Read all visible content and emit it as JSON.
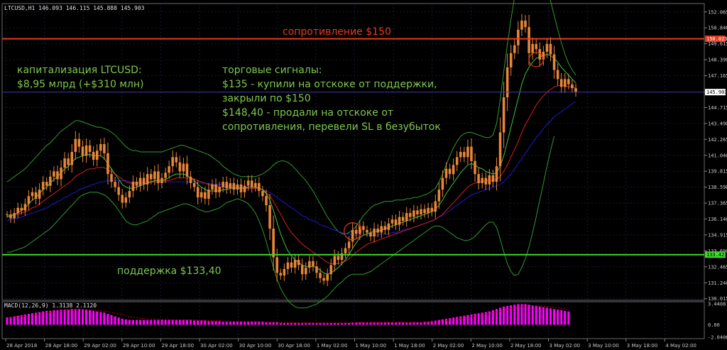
{
  "symbol_info": "LTCUSD,H1  146.093 146.115 145.888 145.903",
  "macd_info": "MACD(12,26,9) 1.3138 2.1120",
  "colors": {
    "resistance": "#e83a1e",
    "support": "#3cdc28",
    "note": "#7ec850",
    "candle": "#e8863a",
    "bb": "#2f9a2f",
    "ma_fast": "#3cc43c",
    "ma_mid": "#d81e1e",
    "ma_slow": "#1a1ad0",
    "macd_hist": "#ff00ff",
    "macd_signal": "#c80000",
    "grid": "#2a2a55",
    "axis_text": "#c8c8c8"
  },
  "annotations": {
    "resistance_label": "сопротивление $150",
    "support_label": "поддержка $133,40",
    "cap_line1": "капитализация LTCUSD:",
    "cap_line2": "$8,95 млрд (+$310 млн)",
    "signals_line1": "торговые сигналы:",
    "signals_line2": "$135 - купили на отскоке от поддержки,",
    "signals_line3": "закрыли по $150",
    "signals_line4": "$148,40 - продали на отскоке от",
    "signals_line5": "сопротивления, перевели SL в безубыток"
  },
  "price_scale": {
    "ticks": [
      "152.065",
      "150.840",
      "149.615",
      "148.390",
      "147.165",
      "145.903",
      "144.715",
      "143.490",
      "142.265",
      "141.040",
      "139.815",
      "138.590",
      "137.365",
      "136.140",
      "134.915",
      "133.690",
      "132.465",
      "131.240",
      "130.015"
    ],
    "resistance_tag": "150.023",
    "support_tag": "133.421",
    "current_tag": "145.903"
  },
  "macd_scale": {
    "ticks": [
      "3.4408",
      "0.00",
      "-2.0406"
    ]
  },
  "time_axis": {
    "labels": [
      "28 Apr 2018",
      "28 Apr 18:00",
      "29 Apr 02:00",
      "29 Apr 10:00",
      "29 Apr 18:00",
      "30 Apr 02:00",
      "30 Apr 10:00",
      "30 Apr 18:00",
      "1 May 02:00",
      "1 May 10:00",
      "1 May 18:00",
      "2 May 02:00",
      "2 May 10:00",
      "2 May 18:00",
      "3 May 02:00",
      "3 May 10:00",
      "3 May 18:00",
      "4 May 02:00"
    ]
  },
  "chart_data": {
    "type": "candlestick",
    "symbol": "LTCUSD",
    "timeframe": "H1",
    "y_range": [
      130.0,
      152.6
    ],
    "resistance": 150.0,
    "support": 133.4,
    "closes": [
      136.5,
      136.2,
      136.6,
      137.0,
      136.8,
      137.3,
      137.9,
      138.2,
      137.7,
      138.4,
      139.0,
      138.7,
      139.4,
      139.8,
      139.2,
      140.1,
      140.8,
      140.3,
      141.3,
      142.3,
      141.7,
      141.0,
      141.8,
      141.3,
      140.7,
      141.4,
      141.9,
      141.2,
      139.6,
      139.0,
      138.6,
      138.0,
      137.4,
      137.8,
      138.3,
      139.0,
      138.7,
      139.3,
      138.8,
      139.6,
      139.2,
      139.8,
      138.9,
      139.3,
      139.7,
      140.2,
      140.9,
      140.5,
      139.8,
      140.4,
      139.4,
      138.9,
      138.6,
      137.8,
      138.2,
      137.7,
      138.4,
      138.8,
      138.2,
      138.6,
      139.0,
      138.5,
      138.9,
      138.4,
      138.8,
      138.2,
      138.7,
      139.1,
      138.6,
      138.9,
      138.3,
      137.9,
      137.2,
      135.4,
      133.2,
      132.0,
      131.8,
      132.3,
      132.8,
      132.4,
      133.0,
      132.6,
      131.9,
      132.4,
      132.9,
      132.5,
      132.0,
      131.6,
      131.4,
      131.9,
      132.6,
      133.3,
      133.0,
      133.5,
      133.9,
      134.4,
      135.3,
      135.0,
      135.6,
      135.3,
      135.1,
      134.8,
      135.4,
      135.1,
      135.6,
      135.3,
      135.8,
      136.1,
      135.7,
      136.3,
      136.0,
      136.6,
      136.3,
      136.8,
      136.5,
      136.9,
      136.6,
      137.0,
      136.7,
      137.5,
      138.4,
      139.3,
      140.0,
      139.6,
      140.3,
      140.9,
      141.3,
      140.9,
      141.7,
      140.6,
      139.6,
      138.9,
      139.3,
      138.8,
      139.5,
      139.0,
      140.2,
      142.8,
      145.5,
      147.8,
      148.9,
      149.5,
      150.7,
      151.4,
      150.9,
      148.9,
      149.6,
      149.2,
      148.4,
      149.0,
      149.6,
      148.8,
      147.6,
      146.9,
      146.3,
      146.9,
      146.5,
      146.2,
      145.9
    ],
    "ma_fast": [
      136.3,
      136.4,
      136.5,
      136.6,
      136.8,
      137.0,
      137.3,
      137.6,
      137.8,
      138.1,
      138.4,
      138.6,
      138.9,
      139.2,
      139.4,
      139.7,
      140.0,
      140.2,
      140.5,
      140.8,
      140.9,
      141.0,
      141.1,
      141.1,
      141.0,
      141.0,
      141.0,
      140.8,
      140.4,
      140.0,
      139.6,
      139.2,
      138.8,
      138.6,
      138.5,
      138.5,
      138.6,
      138.7,
      138.8,
      138.9,
      139.0,
      139.1,
      139.1,
      139.1,
      139.2,
      139.3,
      139.5,
      139.6,
      139.6,
      139.6,
      139.5,
      139.3,
      139.1,
      138.8,
      138.6,
      138.4,
      138.3,
      138.3,
      138.3,
      138.3,
      138.4,
      138.4,
      138.5,
      138.5,
      138.5,
      138.5,
      138.5,
      138.6,
      138.6,
      138.6,
      138.5,
      138.4,
      138.1,
      137.6,
      136.8,
      135.9,
      135.0,
      134.3,
      133.7,
      133.3,
      133.0,
      132.8,
      132.6,
      132.5,
      132.5,
      132.5,
      132.4,
      132.2,
      132.0,
      131.9,
      132.0,
      132.2,
      132.4,
      132.7,
      133.0,
      133.4,
      133.9,
      134.3,
      134.7,
      134.9,
      135.0,
      135.1,
      135.2,
      135.2,
      135.3,
      135.4,
      135.5,
      135.6,
      135.7,
      135.8,
      135.9,
      136.0,
      136.1,
      136.2,
      136.3,
      136.4,
      136.5,
      136.6,
      136.7,
      136.9,
      137.2,
      137.6,
      138.1,
      138.5,
      138.9,
      139.3,
      139.7,
      140.0,
      140.3,
      140.4,
      140.3,
      140.1,
      140.0,
      139.8,
      139.7,
      139.6,
      139.7,
      140.2,
      141.0,
      142.1,
      143.2,
      144.3,
      145.4,
      146.5,
      147.3,
      147.8,
      148.2,
      148.5,
      148.6,
      148.7,
      148.8,
      148.7,
      148.5,
      148.2,
      147.8,
      147.5,
      147.2,
      146.9,
      146.6
    ],
    "ma_mid": [
      136.4,
      136.4,
      136.5,
      136.5,
      136.6,
      136.7,
      136.8,
      137.0,
      137.1,
      137.3,
      137.5,
      137.7,
      137.9,
      138.1,
      138.3,
      138.5,
      138.7,
      138.9,
      139.1,
      139.4,
      139.6,
      139.7,
      139.9,
      140.0,
      140.0,
      140.1,
      140.1,
      140.1,
      139.9,
      139.8,
      139.6,
      139.4,
      139.2,
      139.0,
      138.9,
      138.9,
      138.9,
      138.9,
      138.9,
      138.9,
      139.0,
      139.0,
      139.0,
      139.0,
      139.1,
      139.1,
      139.2,
      139.3,
      139.3,
      139.3,
      139.3,
      139.3,
      139.2,
      139.1,
      139.0,
      138.9,
      138.8,
      138.7,
      138.7,
      138.6,
      138.6,
      138.6,
      138.6,
      138.6,
      138.6,
      138.5,
      138.5,
      138.5,
      138.5,
      138.5,
      138.5,
      138.4,
      138.2,
      137.9,
      137.5,
      137.0,
      136.5,
      136.0,
      135.5,
      135.1,
      134.8,
      134.5,
      134.2,
      134.0,
      133.8,
      133.6,
      133.4,
      133.2,
      133.0,
      132.8,
      132.7,
      132.7,
      132.7,
      132.8,
      132.9,
      133.1,
      133.3,
      133.6,
      133.8,
      134.0,
      134.2,
      134.3,
      134.4,
      134.5,
      134.6,
      134.7,
      134.8,
      134.9,
      135.0,
      135.1,
      135.2,
      135.3,
      135.4,
      135.5,
      135.6,
      135.7,
      135.8,
      135.9,
      136.0,
      136.1,
      136.3,
      136.5,
      136.8,
      137.1,
      137.4,
      137.7,
      138.0,
      138.3,
      138.6,
      138.8,
      138.9,
      139.0,
      139.0,
      139.1,
      139.1,
      139.1,
      139.2,
      139.4,
      139.8,
      140.3,
      140.9,
      141.5,
      142.1,
      142.8,
      143.4,
      143.9,
      144.4,
      144.9,
      145.3,
      145.6,
      145.9,
      146.1,
      146.3,
      146.4,
      146.4,
      146.4,
      146.3,
      146.3,
      146.2
    ],
    "ma_slow": [
      136.0,
      136.1,
      136.2,
      136.2,
      136.3,
      136.4,
      136.5,
      136.6,
      136.7,
      136.8,
      136.9,
      137.0,
      137.2,
      137.3,
      137.5,
      137.6,
      137.8,
      137.9,
      138.1,
      138.2,
      138.4,
      138.5,
      138.6,
      138.7,
      138.8,
      138.9,
      139.0,
      139.0,
      139.1,
      139.1,
      139.1,
      139.1,
      139.1,
      139.1,
      139.0,
      139.0,
      139.0,
      139.0,
      139.0,
      139.0,
      139.0,
      139.0,
      139.0,
      139.0,
      139.0,
      139.0,
      139.0,
      139.0,
      139.0,
      139.0,
      139.0,
      139.0,
      139.0,
      138.9,
      138.9,
      138.9,
      138.9,
      138.8,
      138.8,
      138.8,
      138.8,
      138.7,
      138.7,
      138.7,
      138.7,
      138.6,
      138.6,
      138.6,
      138.6,
      138.5,
      138.5,
      138.4,
      138.3,
      138.2,
      138.0,
      137.8,
      137.6,
      137.4,
      137.2,
      137.0,
      136.8,
      136.6,
      136.4,
      136.3,
      136.1,
      136.0,
      135.9,
      135.7,
      135.6,
      135.5,
      135.4,
      135.3,
      135.2,
      135.1,
      135.0,
      135.0,
      134.9,
      134.9,
      134.9,
      134.9,
      134.9,
      134.9,
      134.9,
      134.9,
      135.0,
      135.0,
      135.0,
      135.1,
      135.1,
      135.2,
      135.3,
      135.4,
      135.4,
      135.5,
      135.6,
      135.7,
      135.8,
      135.9,
      136.0,
      136.1,
      136.3,
      136.4,
      136.6,
      136.8,
      137.0,
      137.2,
      137.4,
      137.6,
      137.8,
      138.0,
      138.1,
      138.2,
      138.3,
      138.4,
      138.5,
      138.6,
      138.7,
      138.8,
      139.0,
      139.3,
      139.6,
      140.0,
      140.4,
      140.8,
      141.2,
      141.6,
      142.0,
      142.4,
      142.7,
      143.1,
      143.4,
      143.7,
      144.0,
      144.2,
      144.4,
      144.6,
      144.8,
      145.0,
      145.2
    ],
    "bb_upper": [
      139.0,
      139.2,
      139.4,
      139.6,
      139.8,
      140.0,
      140.3,
      140.6,
      140.9,
      141.2,
      141.5,
      141.8,
      142.0,
      142.3,
      142.6,
      142.9,
      143.1,
      143.3,
      143.5,
      143.7,
      143.7,
      143.6,
      143.5,
      143.4,
      143.3,
      143.2,
      143.2,
      143.1,
      143.0,
      142.8,
      142.6,
      142.3,
      142.0,
      141.7,
      141.5,
      141.4,
      141.4,
      141.3,
      141.3,
      141.3,
      141.3,
      141.3,
      141.3,
      141.3,
      141.4,
      141.5,
      141.6,
      141.7,
      141.8,
      141.8,
      141.7,
      141.6,
      141.5,
      141.4,
      141.3,
      141.2,
      141.1,
      140.9,
      140.7,
      140.5,
      140.2,
      140.0,
      139.8,
      139.6,
      139.5,
      139.4,
      139.4,
      139.4,
      139.4,
      139.4,
      139.5,
      139.6,
      139.8,
      140.0,
      140.3,
      140.5,
      140.6,
      140.6,
      140.5,
      140.3,
      140.0,
      139.7,
      139.4,
      139.1,
      138.7,
      138.3,
      137.8,
      137.3,
      136.8,
      136.3,
      135.9,
      135.5,
      135.2,
      135.0,
      135.0,
      135.1,
      135.3,
      135.6,
      136.0,
      136.4,
      136.7,
      137.0,
      137.2,
      137.3,
      137.4,
      137.5,
      137.5,
      137.5,
      137.6,
      137.6,
      137.6,
      137.7,
      137.7,
      137.8,
      137.8,
      137.9,
      138.0,
      138.1,
      138.3,
      138.5,
      139.0,
      139.6,
      140.3,
      141.0,
      141.6,
      142.1,
      142.5,
      142.7,
      142.8,
      142.8,
      142.7,
      142.6,
      142.5,
      142.4,
      142.4,
      142.6,
      143.5,
      145.3,
      147.5,
      149.6,
      151.5,
      153.2,
      154.6,
      155.7,
      156.5,
      156.8,
      156.8,
      156.5,
      155.9,
      155.0,
      154.0,
      152.9,
      151.8,
      150.7,
      149.7,
      148.8,
      148.1,
      147.6,
      147.2
    ],
    "bb_lower": [
      133.6,
      133.6,
      133.7,
      133.8,
      133.9,
      134.0,
      134.2,
      134.4,
      134.6,
      134.8,
      135.0,
      135.2,
      135.4,
      135.7,
      136.0,
      136.3,
      136.6,
      136.9,
      137.2,
      137.5,
      137.8,
      138.0,
      138.1,
      138.2,
      138.2,
      138.2,
      138.1,
      138.0,
      137.8,
      137.5,
      137.2,
      136.8,
      136.4,
      136.0,
      135.8,
      135.7,
      135.7,
      135.8,
      135.9,
      136.0,
      136.2,
      136.4,
      136.6,
      136.7,
      136.8,
      136.9,
      137.0,
      137.1,
      137.2,
      137.3,
      137.3,
      137.2,
      137.1,
      136.9,
      136.8,
      136.7,
      136.7,
      136.8,
      136.9,
      137.0,
      137.2,
      137.4,
      137.5,
      137.6,
      137.7,
      137.6,
      137.5,
      137.3,
      137.0,
      136.6,
      136.0,
      135.3,
      134.4,
      133.4,
      132.4,
      131.5,
      130.8,
      130.3,
      129.9,
      129.6,
      129.4,
      129.3,
      129.3,
      129.3,
      129.4,
      129.5,
      129.6,
      129.8,
      130.0,
      130.2,
      130.5,
      130.8,
      131.1,
      131.3,
      131.6,
      131.8,
      131.9,
      131.9,
      131.9,
      131.9,
      132.0,
      132.1,
      132.3,
      132.5,
      132.7,
      132.9,
      133.1,
      133.3,
      133.5,
      133.7,
      133.9,
      134.1,
      134.3,
      134.5,
      134.7,
      134.9,
      135.1,
      135.3,
      135.5,
      135.6,
      135.6,
      135.5,
      135.3,
      135.1,
      134.9,
      134.7,
      134.6,
      134.5,
      134.5,
      134.6,
      134.8,
      135.1,
      135.4,
      135.7,
      135.9,
      135.9,
      135.5,
      134.6,
      133.6,
      132.7,
      132.1,
      131.8,
      131.9,
      132.4,
      133.1,
      134.0,
      135.1,
      136.3,
      137.6,
      138.9,
      140.2,
      141.4,
      142.5
    ],
    "macd_histogram": [
      1.2,
      1.3,
      1.4,
      1.5,
      1.6,
      1.7,
      1.8,
      1.9,
      2.0,
      2.1,
      2.2,
      2.3,
      2.3,
      2.4,
      2.4,
      2.5,
      2.5,
      2.5,
      2.6,
      2.6,
      2.6,
      2.5,
      2.5,
      2.4,
      2.3,
      2.2,
      2.1,
      2.0,
      1.8,
      1.6,
      1.4,
      1.2,
      1.0,
      0.9,
      0.8,
      0.8,
      0.8,
      0.8,
      0.8,
      0.8,
      0.8,
      0.8,
      0.8,
      0.8,
      0.8,
      0.8,
      0.8,
      0.8,
      0.8,
      0.8,
      0.8,
      0.8,
      0.7,
      0.7,
      0.7,
      0.7,
      0.6,
      0.6,
      0.6,
      0.6,
      0.5,
      0.5,
      0.5,
      0.5,
      0.5,
      0.5,
      0.5,
      0.5,
      0.5,
      0.5,
      0.5,
      0.5,
      0.4,
      0.4,
      0.4,
      0.4,
      0.3,
      0.3,
      0.3,
      0.3,
      0.3,
      0.3,
      0.3,
      0.3,
      0.3,
      0.3,
      0.3,
      0.3,
      0.3,
      0.3,
      0.3,
      0.3,
      0.3,
      0.3,
      0.3,
      0.3,
      0.4,
      0.4,
      0.4,
      0.4,
      0.4,
      0.4,
      0.4,
      0.4,
      0.4,
      0.4,
      0.4,
      0.4,
      0.4,
      0.4,
      0.4,
      0.4,
      0.4,
      0.4,
      0.4,
      0.4,
      0.5,
      0.5,
      0.6,
      0.7,
      0.8,
      0.9,
      1.0,
      1.1,
      1.2,
      1.3,
      1.4,
      1.5,
      1.6,
      1.7,
      1.8,
      1.9,
      2.0,
      2.1,
      2.2,
      2.4,
      2.6,
      2.8,
      3.0,
      3.1,
      3.2,
      3.3,
      3.4,
      3.4,
      3.4,
      3.3,
      3.2,
      3.1,
      3.0,
      2.9,
      2.8,
      2.7,
      2.6,
      2.5,
      2.4,
      2.3,
      2.2
    ]
  }
}
